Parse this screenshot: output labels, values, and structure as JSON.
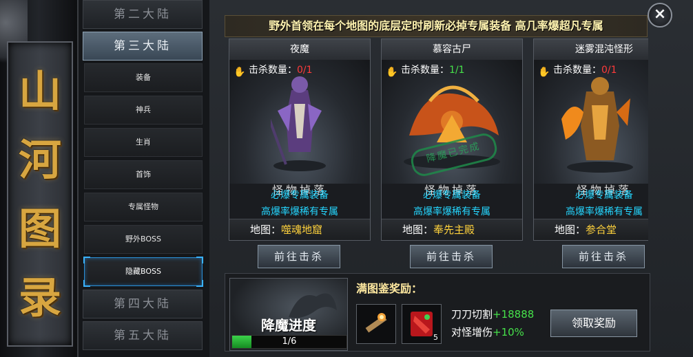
{
  "title_chars": [
    "山",
    "河",
    "图",
    "录"
  ],
  "nav": {
    "continents_top": [
      {
        "label": "第二大陆",
        "active": false
      },
      {
        "label": "第三大陆",
        "active": true
      }
    ],
    "subitems": [
      {
        "label": "装备",
        "active": false
      },
      {
        "label": "神兵",
        "active": false
      },
      {
        "label": "生肖",
        "active": false
      },
      {
        "label": "首饰",
        "active": false
      },
      {
        "label": "专属怪物",
        "active": false
      },
      {
        "label": "野外BOSS",
        "active": false
      },
      {
        "label": "隐藏BOSS",
        "active": true
      }
    ],
    "continents_bottom": [
      {
        "label": "第四大陆",
        "active": false
      },
      {
        "label": "第五大陆",
        "active": false
      }
    ]
  },
  "banner": "野外首领在每个地图的底层定时刷新必掉专属装备 高几率爆超凡专属",
  "close_icon": "×",
  "cards": [
    {
      "name": "夜魔",
      "kill_label": "击杀数量：",
      "kill_count": "0/1",
      "kill_done": false,
      "drop_label": "怪物掉落",
      "drop_lines": [
        "必爆专属装备",
        "高爆率爆稀有专属"
      ],
      "map_label": "地图：",
      "map_value": "噬魂地窟",
      "button": "前往击杀",
      "stamp": ""
    },
    {
      "name": "慕容古尸",
      "kill_label": "击杀数量：",
      "kill_count": "1/1",
      "kill_done": true,
      "drop_label": "怪物掉落",
      "drop_lines": [
        "必爆专属装备",
        "高爆率爆稀有专属"
      ],
      "map_label": "地图：",
      "map_value": "奉先主殿",
      "button": "前往击杀",
      "stamp": "降魔已完成"
    },
    {
      "name": "迷雾混沌怪形",
      "kill_label": "击杀数量：",
      "kill_count": "0/1",
      "kill_done": false,
      "drop_label": "怪物掉落",
      "drop_lines": [
        "必爆专属装备",
        "高爆率爆稀有专属"
      ],
      "map_label": "地图：",
      "map_value": "参合堂",
      "button": "前往击杀",
      "stamp": ""
    }
  ],
  "progress": {
    "title": "降魔进度",
    "text": "1/6",
    "fraction": 0.167
  },
  "reward": {
    "title": "满图鉴奖励：",
    "slots": [
      {
        "icon": "scroll-icon",
        "count": ""
      },
      {
        "icon": "red-card-icon",
        "count": "5"
      }
    ],
    "stats": [
      {
        "label": "刀刀切割",
        "value": "+18888"
      },
      {
        "label": "对怪增伤",
        "value": "+10%"
      }
    ],
    "claim_button": "领取奖励"
  }
}
